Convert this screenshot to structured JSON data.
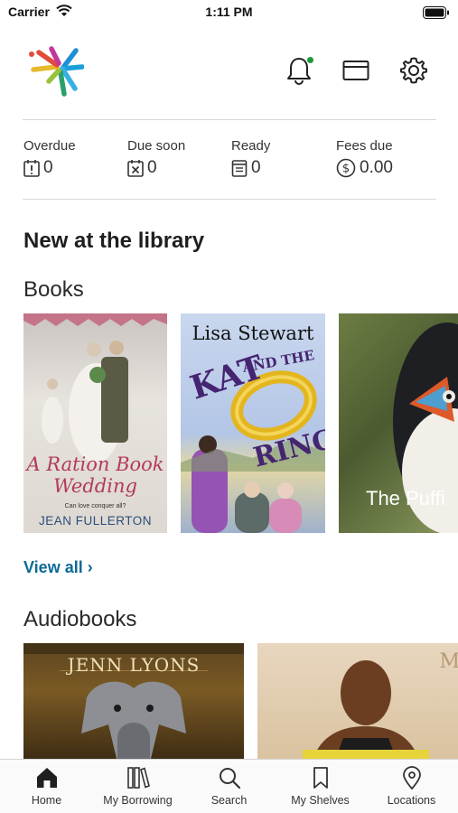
{
  "status_bar": {
    "carrier": "Carrier",
    "time": "1:11 PM"
  },
  "header": {
    "logo_icon": "library-starburst-logo",
    "actions": [
      {
        "icon": "bell-icon",
        "has_notification": true
      },
      {
        "icon": "library-card-icon"
      },
      {
        "icon": "gear-icon"
      }
    ]
  },
  "summary": [
    {
      "label": "Overdue",
      "value": "0",
      "icon": "overdue-icon"
    },
    {
      "label": "Due soon",
      "value": "0",
      "icon": "due-soon-icon"
    },
    {
      "label": "Ready",
      "value": "0",
      "icon": "ready-icon"
    },
    {
      "label": "Fees due",
      "value": "0.00",
      "icon": "dollar-icon"
    }
  ],
  "main": {
    "title": "New at the library",
    "books": {
      "heading": "Books",
      "items": [
        {
          "title": "A Ration Book",
          "title2": "Wedding",
          "tagline": "Can love conquer all?",
          "author": "JEAN FULLERTON"
        },
        {
          "author": "Lisa Stewart",
          "title_a": "KAT",
          "title_b": "AND THE",
          "title_c": "RING"
        },
        {
          "title": "The Puffi"
        }
      ],
      "view_all": "View all ›"
    },
    "audiobooks": {
      "heading": "Audiobooks",
      "items": [
        {
          "author": "JENN LYONS"
        },
        {
          "monogram": "M"
        }
      ]
    }
  },
  "tabbar": {
    "tabs": [
      {
        "label": "Home",
        "icon": "home-icon",
        "active": true
      },
      {
        "label": "My Borrowing",
        "icon": "books-icon"
      },
      {
        "label": "Search",
        "icon": "search-icon"
      },
      {
        "label": "My Shelves",
        "icon": "bookmark-icon"
      },
      {
        "label": "Locations",
        "icon": "location-pin-icon"
      }
    ]
  },
  "colors": {
    "accent": "#0d6a96",
    "notification": "#1a9a3a"
  }
}
